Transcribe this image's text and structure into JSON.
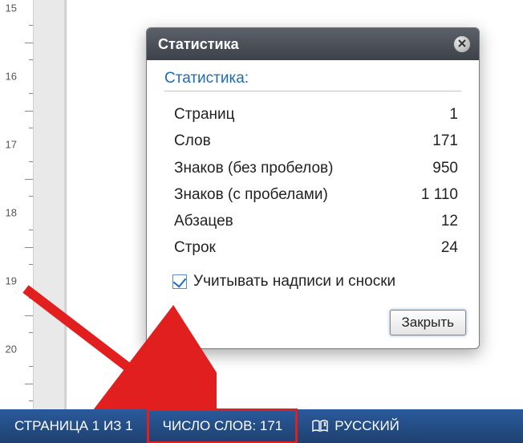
{
  "dialog": {
    "title": "Статистика",
    "group_label": "Статистика:",
    "rows": [
      {
        "label": "Страниц",
        "value": "1"
      },
      {
        "label": "Слов",
        "value": "171"
      },
      {
        "label": "Знаков (без пробелов)",
        "value": "950"
      },
      {
        "label": "Знаков (с пробелами)",
        "value": "1 110"
      },
      {
        "label": "Абзацев",
        "value": "12"
      },
      {
        "label": "Строк",
        "value": "24"
      }
    ],
    "checkbox_label": "Учитывать надписи и сноски",
    "close_button": "Закрыть"
  },
  "statusbar": {
    "page": "СТРАНИЦА 1 ИЗ 1",
    "words": "ЧИСЛО СЛОВ: 171",
    "language": "РУССКИЙ"
  },
  "ruler_numbers": [
    "15",
    "16",
    "17",
    "18",
    "19",
    "20"
  ]
}
